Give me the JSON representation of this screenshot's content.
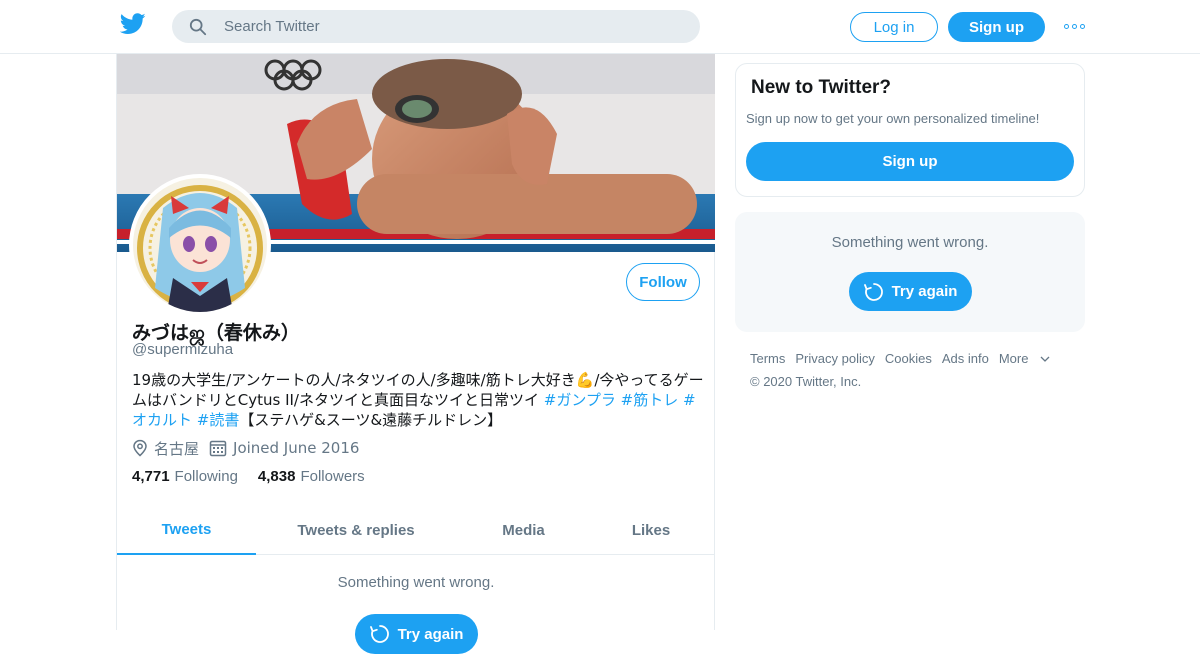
{
  "header": {
    "logo_icon": "twitter-bird-icon",
    "search_placeholder": "Search Twitter",
    "login_label": "Log in",
    "signup_label": "Sign up",
    "more_icon": "more-dots-icon",
    "accent_color": "#1da1f2"
  },
  "profile": {
    "name": "みづはஜ（春休み）",
    "handle": "@supermizuha",
    "follow_label": "Follow",
    "bio_parts": {
      "text1": "19歳の大学生/アンケートの人/ネタツイの人/多趣味/筋トレ大好き💪/今やってるゲームはバンドリとCytus II/ネタツイと真面目なツイと日常ツイ ",
      "tag1": "#ガンプラ",
      "tag2": "#筋トレ",
      "tag3": "#オカルト",
      "tag4": "#読書",
      "text2": "【ステハゲ&スーツ&遠藤チルドレン】"
    },
    "location": "名古屋",
    "joined": "Joined June 2016",
    "following_count": "4,771",
    "following_label": "Following",
    "followers_count": "4,838",
    "followers_label": "Followers"
  },
  "tabs": [
    {
      "label": "Tweets",
      "active": true
    },
    {
      "label": "Tweets & replies",
      "active": false
    },
    {
      "label": "Media",
      "active": false
    },
    {
      "label": "Likes",
      "active": false
    }
  ],
  "timeline": {
    "error_message": "Something went wrong.",
    "retry_label": "Try again"
  },
  "sidebar": {
    "new_title": "New to Twitter?",
    "new_subtitle": "Sign up now to get your own personalized timeline!",
    "signup_label": "Sign up",
    "error_message": "Something went wrong.",
    "retry_label": "Try again"
  },
  "footer": {
    "links": [
      "Terms",
      "Privacy policy",
      "Cookies",
      "Ads info",
      "More"
    ],
    "copyright": "© 2020 Twitter, Inc."
  }
}
